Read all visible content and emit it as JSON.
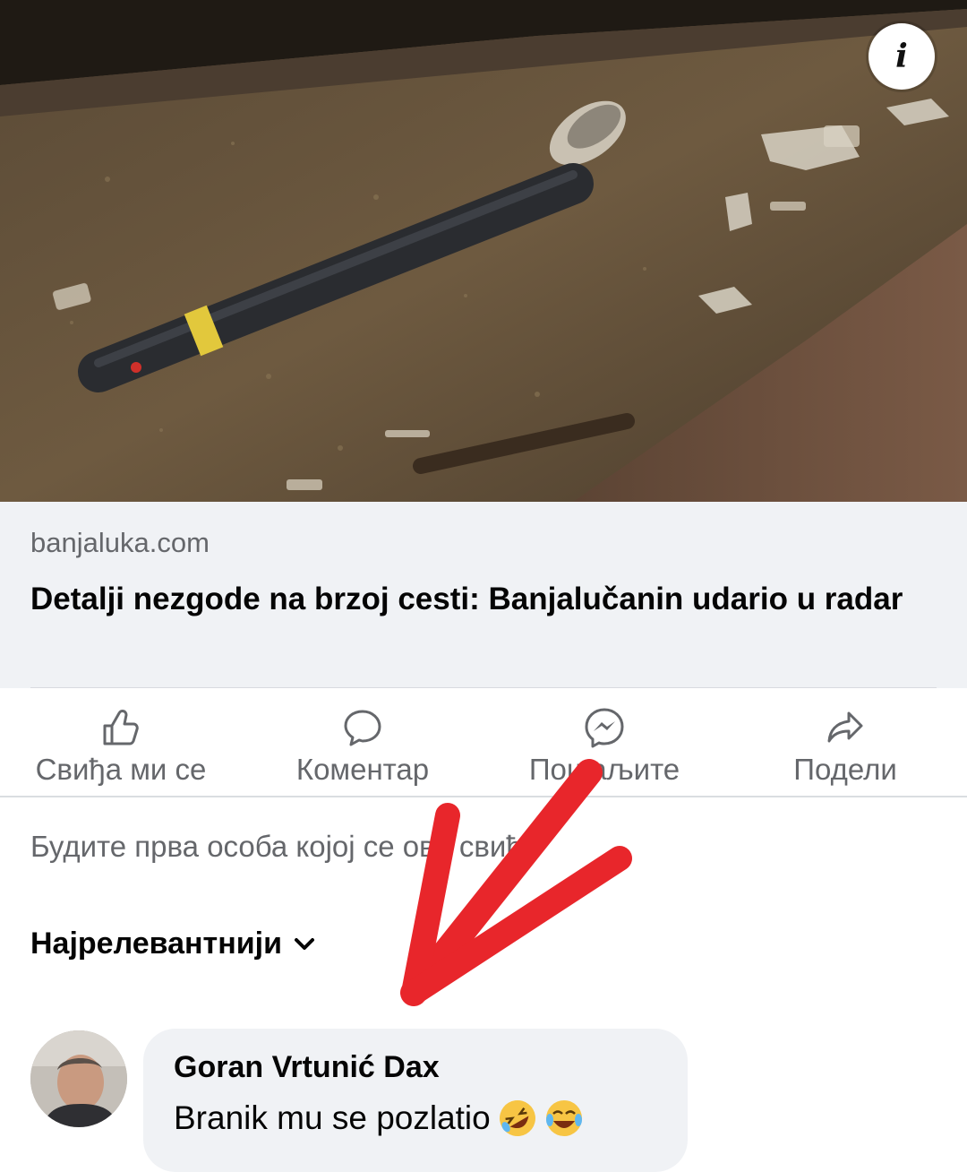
{
  "post": {
    "photo_description": "",
    "info_icon_label": "i"
  },
  "link": {
    "domain": "banjaluka.com",
    "title": "Detalji nezgode na brzoj cesti: Banjalučanin udario u radar"
  },
  "actions": [
    {
      "label": "Свиђа ми се",
      "icon": "thumbs-up-icon"
    },
    {
      "label": "Коментар",
      "icon": "comment-icon"
    },
    {
      "label": "Пошаљите",
      "icon": "messenger-icon"
    },
    {
      "label": "Подели",
      "icon": "share-icon"
    }
  ],
  "reactions": {
    "first_like_prompt": "Будите прва особа којој се ово свиђа"
  },
  "comments": {
    "sort_label": "Најрелевантнији",
    "sort_icon": "chevron-down-icon",
    "items": [
      {
        "author": "Goran Vrtunić Dax",
        "text": "Branik mu se pozlatio",
        "emojis": [
          "rolling-laughing-emoji",
          "tears-of-joy-emoji"
        ]
      }
    ]
  },
  "colors": {
    "secondary_text": "#65676b",
    "primary_text": "#050505",
    "preview_bg": "#f0f2f5",
    "annotation_arrow": "#e8262b"
  }
}
